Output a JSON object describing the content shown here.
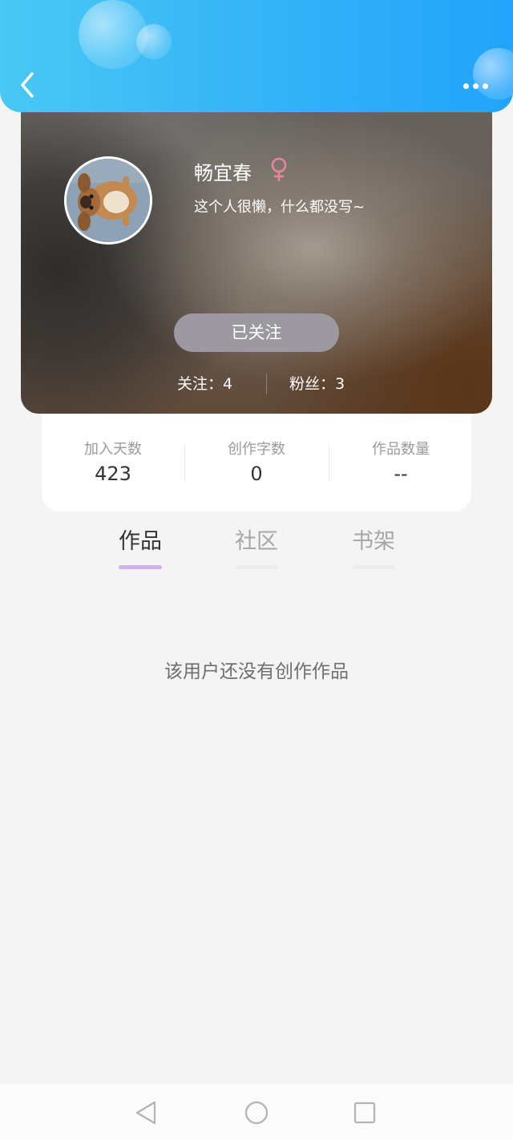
{
  "header": {
    "back_icon": "chevron-left-icon",
    "more_icon": "more-horizontal-icon"
  },
  "profile": {
    "username": "畅宜春",
    "gender_icon": "female-icon",
    "gender_color": "#e9849c",
    "bio": "这个人很懒，什么都没写~",
    "follow_button_label": "已关注",
    "following": "关注：4",
    "followers": "粉丝：3"
  },
  "stats": [
    {
      "label": "加入天数",
      "value": "423"
    },
    {
      "label": "创作字数",
      "value": "0"
    },
    {
      "label": "作品数量",
      "value": "--"
    }
  ],
  "tabs": [
    {
      "label": "作品",
      "active": true
    },
    {
      "label": "社区",
      "active": false
    },
    {
      "label": "书架",
      "active": false
    }
  ],
  "empty_state": {
    "message": "该用户还没有创作作品"
  },
  "system_nav": {
    "back_icon": "triangle-back-icon",
    "home_icon": "circle-home-icon",
    "recents_icon": "square-recents-icon"
  },
  "colors": {
    "header_gradient_start": "#49c8f5",
    "header_gradient_end": "#22a4fb",
    "active_tab_underline": "#cdb2ec",
    "follow_button_bg": "#9c9aa0"
  }
}
